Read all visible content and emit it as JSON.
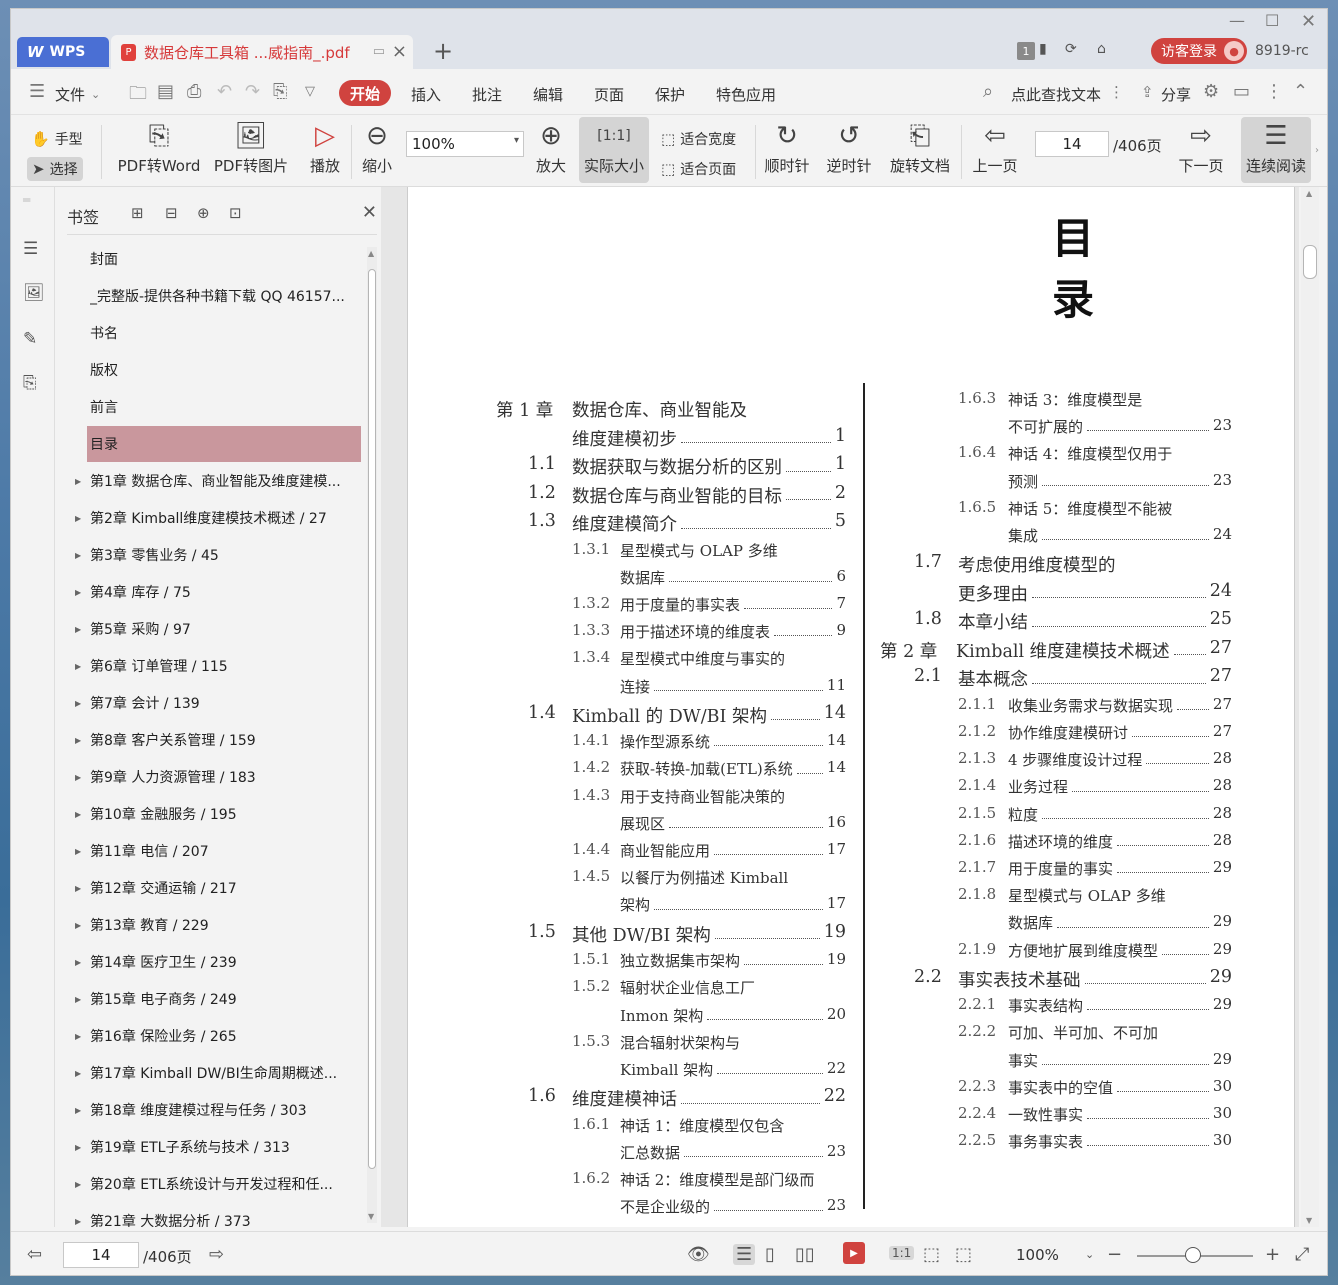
{
  "titlebar": {
    "app_tab": "WPS",
    "doc_tab": "数据仓库工具箱 ...威指南_.pdf",
    "page_badge": "1",
    "login": "访客登录",
    "user_id": "8919-rc"
  },
  "menubar": {
    "file": "文件",
    "tabs": [
      "开始",
      "插入",
      "批注",
      "编辑",
      "页面",
      "保护",
      "特色应用"
    ],
    "search": "点此查找文本",
    "share": "分享"
  },
  "toolbar": {
    "hand": "手型",
    "select": "选择",
    "pdf_to_word": "PDF转Word",
    "pdf_to_image": "PDF转图片",
    "play": "播放",
    "zoom_out": "缩小",
    "zoom_value": "100%",
    "zoom_in": "放大",
    "actual_size": "实际大小",
    "fit_width": "适合宽度",
    "fit_page": "适合页面",
    "clockwise": "顺时针",
    "counter_clockwise": "逆时针",
    "rotate_doc": "旋转文档",
    "prev_page": "上一页",
    "page_value": "14",
    "page_total": "/406页",
    "next_page": "下一页",
    "continuous": "连续阅读"
  },
  "bookmarks": {
    "title": "书签",
    "items": [
      {
        "label": "封面",
        "expandable": false
      },
      {
        "label": "_完整版-提供各种书籍下载 QQ 46157...",
        "expandable": false
      },
      {
        "label": "书名",
        "expandable": false
      },
      {
        "label": "版权",
        "expandable": false
      },
      {
        "label": "前言",
        "expandable": false
      },
      {
        "label": "目录",
        "expandable": false,
        "selected": true
      },
      {
        "label": "第1章 数据仓库、商业智能及维度建模...",
        "expandable": true
      },
      {
        "label": "第2章 Kimball维度建模技术概述 / 27",
        "expandable": true
      },
      {
        "label": "第3章 零售业务 / 45",
        "expandable": true
      },
      {
        "label": "第4章 库存 / 75",
        "expandable": true
      },
      {
        "label": "第5章 采购 / 97",
        "expandable": true
      },
      {
        "label": "第6章 订单管理 / 115",
        "expandable": true
      },
      {
        "label": "第7章 会计 / 139",
        "expandable": true
      },
      {
        "label": "第8章 客户关系管理 / 159",
        "expandable": true
      },
      {
        "label": "第9章 人力资源管理 / 183",
        "expandable": true
      },
      {
        "label": "第10章 金融服务 / 195",
        "expandable": true
      },
      {
        "label": "第11章 电信 / 207",
        "expandable": true
      },
      {
        "label": "第12章 交通运输 / 217",
        "expandable": true
      },
      {
        "label": "第13章 教育 / 229",
        "expandable": true
      },
      {
        "label": "第14章 医疗卫生 / 239",
        "expandable": true
      },
      {
        "label": "第15章 电子商务 / 249",
        "expandable": true
      },
      {
        "label": "第16章 保险业务 / 265",
        "expandable": true
      },
      {
        "label": "第17章 Kimball DW/BI生命周期概述...",
        "expandable": true
      },
      {
        "label": "第18章 维度建模过程与任务 / 303",
        "expandable": true
      },
      {
        "label": "第19章 ETL子系统与技术 / 313",
        "expandable": true
      },
      {
        "label": "第20章 ETL系统设计与开发过程和任...",
        "expandable": true
      },
      {
        "label": "第21章 大数据分析 / 373",
        "expandable": true
      }
    ]
  },
  "document": {
    "title": "目录",
    "left_column": [
      {
        "num": "第 1 章",
        "text": "数据仓库、商业智能及",
        "page": "",
        "level": 0
      },
      {
        "num": "",
        "text": "维度建模初步",
        "page": "1",
        "level": 0
      },
      {
        "num": "1.1",
        "text": "数据获取与数据分析的区别",
        "page": "1",
        "level": 1
      },
      {
        "num": "1.2",
        "text": "数据仓库与商业智能的目标",
        "page": "2",
        "level": 1
      },
      {
        "num": "1.3",
        "text": "维度建模简介",
        "page": "5",
        "level": 1
      },
      {
        "num": "1.3.1",
        "text": "星型模式与 OLAP 多维",
        "page": "",
        "level": 2
      },
      {
        "num": "",
        "text": "数据库",
        "page": "6",
        "level": 2
      },
      {
        "num": "1.3.2",
        "text": "用于度量的事实表",
        "page": "7",
        "level": 2
      },
      {
        "num": "1.3.3",
        "text": "用于描述环境的维度表",
        "page": "9",
        "level": 2
      },
      {
        "num": "1.3.4",
        "text": "星型模式中维度与事实的",
        "page": "",
        "level": 2
      },
      {
        "num": "",
        "text": "连接",
        "page": "11",
        "level": 2
      },
      {
        "num": "1.4",
        "text": "Kimball 的 DW/BI 架构",
        "page": "14",
        "level": 1
      },
      {
        "num": "1.4.1",
        "text": "操作型源系统",
        "page": "14",
        "level": 2
      },
      {
        "num": "1.4.2",
        "text": "获取-转换-加载(ETL)系统",
        "page": "14",
        "level": 2
      },
      {
        "num": "1.4.3",
        "text": "用于支持商业智能决策的",
        "page": "",
        "level": 2
      },
      {
        "num": "",
        "text": "展现区",
        "page": "16",
        "level": 2
      },
      {
        "num": "1.4.4",
        "text": "商业智能应用",
        "page": "17",
        "level": 2
      },
      {
        "num": "1.4.5",
        "text": "以餐厅为例描述 Kimball",
        "page": "",
        "level": 2
      },
      {
        "num": "",
        "text": "架构",
        "page": "17",
        "level": 2
      },
      {
        "num": "1.5",
        "text": "其他 DW/BI 架构",
        "page": "19",
        "level": 1
      },
      {
        "num": "1.5.1",
        "text": "独立数据集市架构",
        "page": "19",
        "level": 2
      },
      {
        "num": "1.5.2",
        "text": "辐射状企业信息工厂",
        "page": "",
        "level": 2
      },
      {
        "num": "",
        "text": "Inmon 架构",
        "page": "20",
        "level": 2
      },
      {
        "num": "1.5.3",
        "text": "混合辐射状架构与",
        "page": "",
        "level": 2
      },
      {
        "num": "",
        "text": "Kimball 架构",
        "page": "22",
        "level": 2
      },
      {
        "num": "1.6",
        "text": "维度建模神话",
        "page": "22",
        "level": 1
      },
      {
        "num": "1.6.1",
        "text": "神话 1：维度模型仅包含",
        "page": "",
        "level": 2
      },
      {
        "num": "",
        "text": "汇总数据",
        "page": "23",
        "level": 2
      },
      {
        "num": "1.6.2",
        "text": "神话 2：维度模型是部门级而",
        "page": "",
        "level": 2
      },
      {
        "num": "",
        "text": "不是企业级的",
        "page": "23",
        "level": 2
      }
    ],
    "right_column": [
      {
        "num": "1.6.3",
        "text": "神话 3：维度模型是",
        "page": "",
        "level": 2
      },
      {
        "num": "",
        "text": "不可扩展的",
        "page": "23",
        "level": 2
      },
      {
        "num": "1.6.4",
        "text": "神话 4：维度模型仅用于",
        "page": "",
        "level": 2
      },
      {
        "num": "",
        "text": "预测",
        "page": "23",
        "level": 2
      },
      {
        "num": "1.6.5",
        "text": "神话 5：维度模型不能被",
        "page": "",
        "level": 2
      },
      {
        "num": "",
        "text": "集成",
        "page": "24",
        "level": 2
      },
      {
        "num": "1.7",
        "text": "考虑使用维度模型的",
        "page": "",
        "level": 1
      },
      {
        "num": "",
        "text": "更多理由",
        "page": "24",
        "level": 1
      },
      {
        "num": "1.8",
        "text": "本章小结",
        "page": "25",
        "level": 1
      },
      {
        "num": "第 2 章",
        "text": "Kimball 维度建模技术概述",
        "page": "27",
        "level": 0
      },
      {
        "num": "2.1",
        "text": "基本概念",
        "page": "27",
        "level": 1
      },
      {
        "num": "2.1.1",
        "text": "收集业务需求与数据实现",
        "page": "27",
        "level": 2
      },
      {
        "num": "2.1.2",
        "text": "协作维度建模研讨",
        "page": "27",
        "level": 2
      },
      {
        "num": "2.1.3",
        "text": "4 步骤维度设计过程",
        "page": "28",
        "level": 2
      },
      {
        "num": "2.1.4",
        "text": "业务过程",
        "page": "28",
        "level": 2
      },
      {
        "num": "2.1.5",
        "text": "粒度",
        "page": "28",
        "level": 2
      },
      {
        "num": "2.1.6",
        "text": "描述环境的维度",
        "page": "28",
        "level": 2
      },
      {
        "num": "2.1.7",
        "text": "用于度量的事实",
        "page": "29",
        "level": 2
      },
      {
        "num": "2.1.8",
        "text": "星型模式与 OLAP 多维",
        "page": "",
        "level": 2
      },
      {
        "num": "",
        "text": "数据库",
        "page": "29",
        "level": 2
      },
      {
        "num": "2.1.9",
        "text": "方便地扩展到维度模型",
        "page": "29",
        "level": 2
      },
      {
        "num": "2.2",
        "text": "事实表技术基础",
        "page": "29",
        "level": 1
      },
      {
        "num": "2.2.1",
        "text": "事实表结构",
        "page": "29",
        "level": 2
      },
      {
        "num": "2.2.2",
        "text": "可加、半可加、不可加",
        "page": "",
        "level": 2
      },
      {
        "num": "",
        "text": "事实",
        "page": "29",
        "level": 2
      },
      {
        "num": "2.2.3",
        "text": "事实表中的空值",
        "page": "30",
        "level": 2
      },
      {
        "num": "2.2.4",
        "text": "一致性事实",
        "page": "30",
        "level": 2
      },
      {
        "num": "2.2.5",
        "text": "事务事实表",
        "page": "30",
        "level": 2
      }
    ]
  },
  "statusbar": {
    "page_value": "14",
    "page_total": "/406页",
    "zoom": "100%"
  }
}
